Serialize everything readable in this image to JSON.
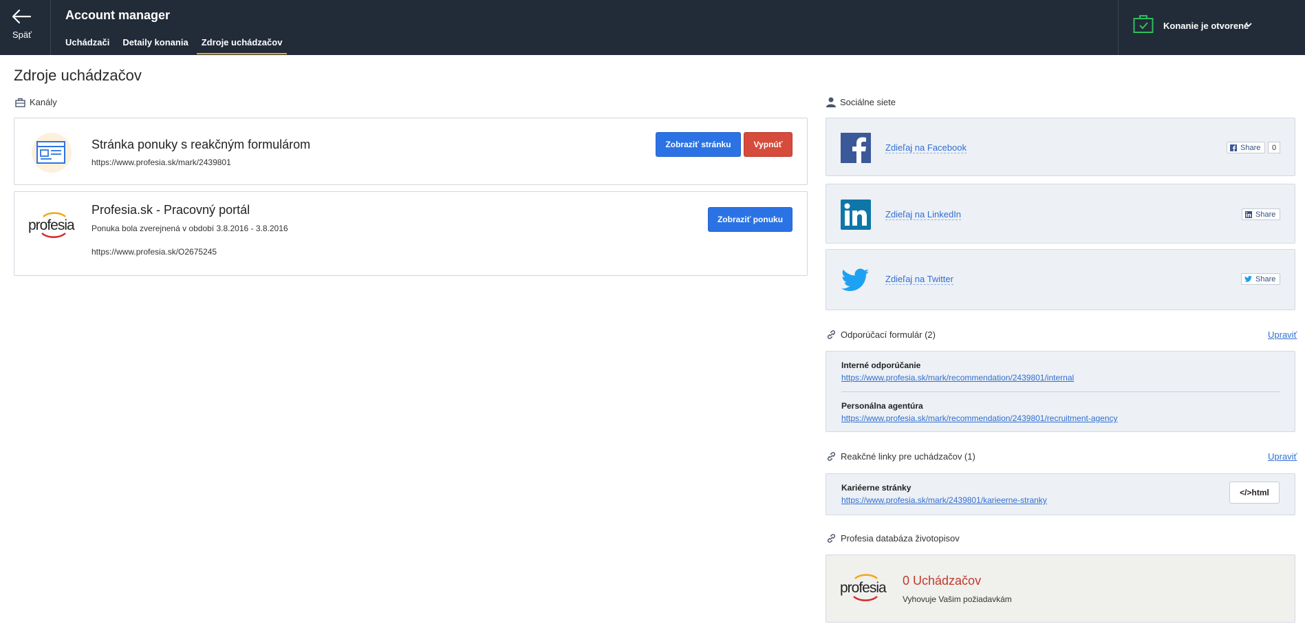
{
  "header": {
    "back_label": "Späť",
    "app_title": "Account manager",
    "tabs": [
      {
        "label": "Uchádzači"
      },
      {
        "label": "Detaily konania"
      },
      {
        "label": "Zdroje uchádzačov"
      }
    ],
    "status": "Konanie je otvorené",
    "status_color": "#2fbf5e"
  },
  "page": {
    "title": "Zdroje uchádzačov"
  },
  "channels": {
    "label": "Kanály",
    "cards": [
      {
        "title": "Stránka ponuky s reakčným formulárom",
        "url": "https://www.profesia.sk/mark/2439801",
        "buttons": {
          "view": "Zobraziť stránku",
          "disable": "Vypnúť"
        }
      },
      {
        "title": "Profesia.sk - Pracovný portál",
        "period": "Ponuka bola zverejnená v období 3.8.2016 - 3.8.2016",
        "url": "https://www.profesia.sk/O2675245",
        "logo_text": "profesia",
        "buttons": {
          "view": "Zobraziť ponuku"
        }
      }
    ]
  },
  "social": {
    "label": "Sociálne siete",
    "items": [
      {
        "name": "facebook",
        "link": "Zdieľaj na Facebook",
        "share": "Share",
        "count": "0",
        "color": "#3b5998"
      },
      {
        "name": "linkedin",
        "link": "Zdieľaj na LinkedIn",
        "share": "Share",
        "color": "#0e76a8"
      },
      {
        "name": "twitter",
        "link": "Zdieľaj na Twitter",
        "share": "Share",
        "color": "#1da1f2"
      }
    ]
  },
  "referral": {
    "label": "Odporúčací formulár (2)",
    "edit": "Upraviť",
    "items": [
      {
        "name": "Interné odporúčanie",
        "url": "https://www.profesia.sk/mark/recommendation/2439801/internal"
      },
      {
        "name": "Personálna agentúra",
        "url": "https://www.profesia.sk/mark/recommendation/2439801/recruitment-agency"
      }
    ]
  },
  "reaction_links": {
    "label": "Reakčné linky pre uchádzačov (1)",
    "edit": "Upraviť",
    "items": [
      {
        "name": "Kariéerne stránky",
        "url": "https://www.profesia.sk/mark/2439801/karieerne-stranky",
        "button": "</>html"
      }
    ]
  },
  "cv_database": {
    "label": "Profesia databáza životopisov",
    "logo_text": "profesia",
    "count": "0 Uchádzačov",
    "description": "Vyhovuje Vašim požiadavkám"
  }
}
